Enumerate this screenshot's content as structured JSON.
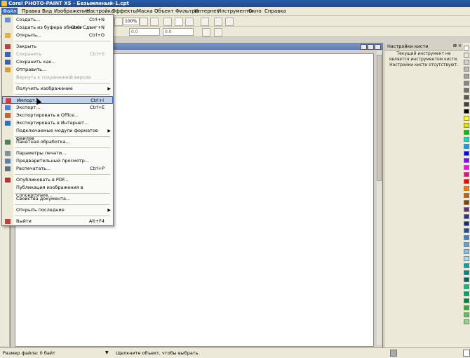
{
  "window": {
    "title": "Corel PHOTO-PAINT X5 - Безымянный-1.cpt"
  },
  "menubar": {
    "items": [
      "Файл",
      "Правка",
      "Вид",
      "Изображение",
      "Настройка",
      "Эффекты",
      "Маска",
      "Объект",
      "Фильтры",
      "Интернет",
      "Инструменты",
      "Окно",
      "Справка"
    ],
    "active": "Файл"
  },
  "toolbar": {
    "zoom_value": "100%",
    "field1_value": "0,0",
    "field2_value": "0,0",
    "field3_value": "0,0",
    "field4_value": "0,0"
  },
  "file_menu": {
    "items": [
      {
        "label": "Создать...",
        "shortcut": "Ctrl+N",
        "icon": "new-document-icon"
      },
      {
        "label": "Создать из буфера обмена",
        "shortcut": "Ctrl+Сдвиг+N",
        "icon": ""
      },
      {
        "label": "Открыть...",
        "shortcut": "Ctrl+O",
        "icon": "open-folder-icon"
      },
      {
        "label": "Закрыть",
        "shortcut": "",
        "icon": "close-document-icon"
      },
      {
        "label": "Сохранить",
        "shortcut": "Ctrl+S",
        "icon": "save-icon",
        "disabled": true
      },
      {
        "label": "Сохранить как...",
        "shortcut": "",
        "icon": "save-as-icon"
      },
      {
        "label": "Отправить...",
        "shortcut": "",
        "icon": "send-mail-icon"
      },
      {
        "label": "Вернуть к сохраненной версии",
        "shortcut": "",
        "icon": "",
        "disabled": true
      },
      {
        "label": "Получить изображение",
        "shortcut": "",
        "icon": "",
        "submenu": true
      },
      {
        "label": "Импорт...",
        "shortcut": "Ctrl+I",
        "icon": "import-icon",
        "highlighted": true
      },
      {
        "label": "Экспорт...",
        "shortcut": "Ctrl+E",
        "icon": "export-icon"
      },
      {
        "label": "Экспортировать в Office...",
        "shortcut": "",
        "icon": "office-icon"
      },
      {
        "label": "Экспортировать в Интернет...",
        "shortcut": "",
        "icon": "web-icon"
      },
      {
        "label": "Подключаемые модули форматов файлов",
        "shortcut": "",
        "icon": "",
        "submenu": true
      },
      {
        "label": "Пакетная обработка...",
        "shortcut": "",
        "icon": "batch-icon"
      },
      {
        "label": "Параметры печати...",
        "shortcut": "",
        "icon": "print-setup-icon"
      },
      {
        "label": "Предварительный просмотр...",
        "shortcut": "",
        "icon": "print-preview-icon"
      },
      {
        "label": "Распечатать...",
        "shortcut": "Ctrl+P",
        "icon": "print-icon"
      },
      {
        "label": "Опубликовать в PDF...",
        "shortcut": "",
        "icon": "pdf-icon"
      },
      {
        "label": "Публикация изображения в ConceptShare...",
        "shortcut": "",
        "icon": ""
      },
      {
        "label": "Свойства документа...",
        "shortcut": "",
        "icon": ""
      },
      {
        "label": "Открыть последние",
        "shortcut": "",
        "icon": "",
        "submenu": true
      },
      {
        "label": "Выйти",
        "shortcut": "Alt+F4",
        "icon": "exit-icon"
      }
    ]
  },
  "docker": {
    "title": "Настройки кисти",
    "message": "Текущий инструмент не является инструментом кисти. Настройки кисти отсутствуют."
  },
  "palette": {
    "colors": [
      "#ffffff",
      "#e8e8e8",
      "#d0d0d0",
      "#b8b8b8",
      "#a0a0a0",
      "#888888",
      "#707070",
      "#585858",
      "#404040",
      "#000000",
      "#ffff00",
      "#e0e000",
      "#00c000",
      "#00e0c0",
      "#00a0ff",
      "#0000ff",
      "#8000ff",
      "#ff00ff",
      "#ff0080",
      "#ff0000",
      "#ff8000",
      "#c06000",
      "#804000",
      "#603080",
      "#303080",
      "#103070",
      "#205090",
      "#4080c0",
      "#60a0e0",
      "#80c0f0",
      "#a0e0ff",
      "#00a0a0",
      "#008080",
      "#006060",
      "#00c080",
      "#00a060",
      "#008040",
      "#30b030",
      "#60c060",
      "#90d090"
    ]
  },
  "status": {
    "file_size": "Размер файла: 0 байт",
    "hint": "Щелкните объект, чтобы выбрать"
  }
}
